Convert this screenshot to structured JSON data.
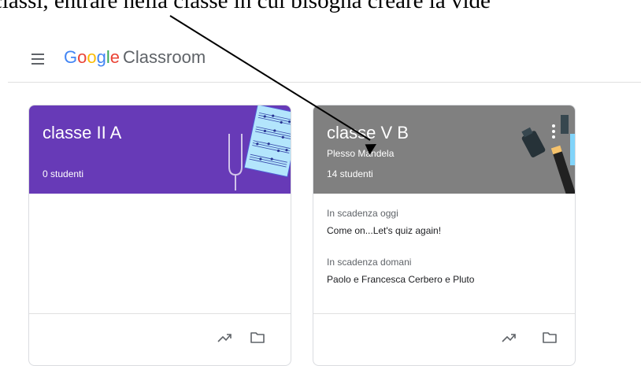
{
  "instruction_text": "classi, entrare nella classe in cui bisogna creare la vide",
  "header": {
    "brand": {
      "g1": "G",
      "g2": "o",
      "g3": "o",
      "g4": "g",
      "g5": "l",
      "g6": "e"
    },
    "product": "Classroom",
    "menu_icon": "hamburger-menu-icon"
  },
  "classes": [
    {
      "title": "classe II A",
      "section": "",
      "students": "0 studenti",
      "color": "#673ab7",
      "illustration": "music-sheet-tuning-fork",
      "due": []
    },
    {
      "title": "classe V B",
      "section": "Plesso Mandela",
      "students": "14 studenti",
      "color": "#808080",
      "illustration": "paint-brushes",
      "due": [
        {
          "label": "In scadenza oggi",
          "item": "Come on...Let's quiz again!"
        },
        {
          "label": "In scadenza domani",
          "item": "Paolo e Francesca Cerbero e Pluto"
        }
      ]
    }
  ],
  "colors": {
    "text_secondary": "#5f6368",
    "divider": "#e0e0e0",
    "card_border": "#dadce0",
    "annotation_arrow": "#000000"
  },
  "icons": [
    "trending-up-icon",
    "folder-icon",
    "more-vert-icon"
  ]
}
